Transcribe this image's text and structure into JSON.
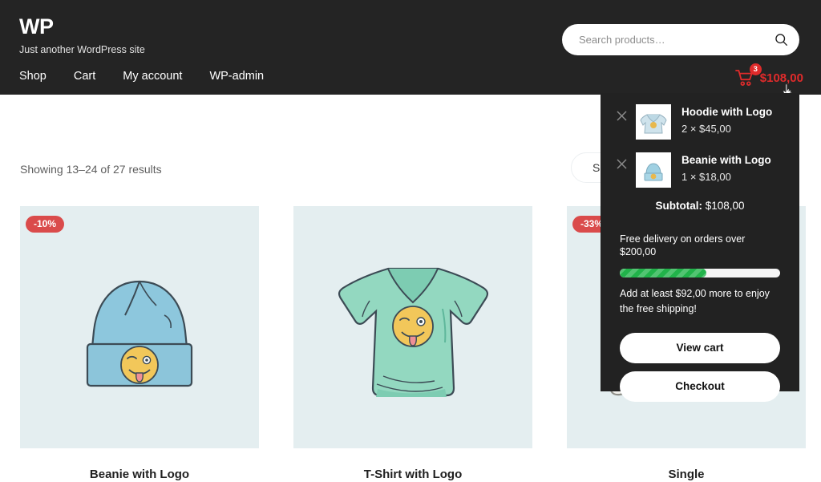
{
  "header": {
    "brand_title": "WP",
    "tagline": "Just another WordPress site",
    "nav": [
      {
        "label": "Shop"
      },
      {
        "label": "Cart"
      },
      {
        "label": "My account"
      },
      {
        "label": "WP-admin"
      }
    ],
    "search": {
      "placeholder": "Search products…",
      "value": "",
      "submit_icon": "search-icon"
    },
    "cart": {
      "icon": "shopping-cart-icon",
      "count": "3",
      "amount": "$108,00",
      "accent_color": "#e02b2b"
    },
    "background_color": "#242424"
  },
  "shop": {
    "result_count": "Showing 13–24 of 27 results",
    "ordering_label": "Sort by popularity",
    "products": [
      {
        "title": "Beanie with Logo",
        "badge": "-10%",
        "image": "beanie-blue-with-winking-emoji",
        "thumb_bg": "#e4eef0"
      },
      {
        "title": "T-Shirt with Logo",
        "badge": "",
        "image": "tshirt-mint-with-winking-emoji",
        "thumb_bg": "#e4eef0"
      },
      {
        "title": "Single",
        "badge": "-33%",
        "image": "single-product-white-object",
        "thumb_bg": "#e4eef0"
      }
    ]
  },
  "mini_cart": {
    "items": [
      {
        "remove_icon": "close-icon",
        "thumb": "hoodie-thumbnail",
        "name": "Hoodie with Logo",
        "quantity_price": "2 × $45,00"
      },
      {
        "remove_icon": "close-icon",
        "thumb": "beanie-thumbnail",
        "name": "Beanie with Logo",
        "quantity_price": "1 × $18,00"
      }
    ],
    "subtotal_label": "Subtotal:",
    "subtotal_value": "$108,00",
    "free_shipping": {
      "notice": "Free delivery on orders over $200,00",
      "progress_percent": 54,
      "progress_color": "#21b34a",
      "remaining_text": "Add at least $92,00 more to enjoy the free shipping!"
    },
    "buttons": {
      "view_cart": "View cart",
      "checkout": "Checkout"
    },
    "background_color": "#222222"
  }
}
